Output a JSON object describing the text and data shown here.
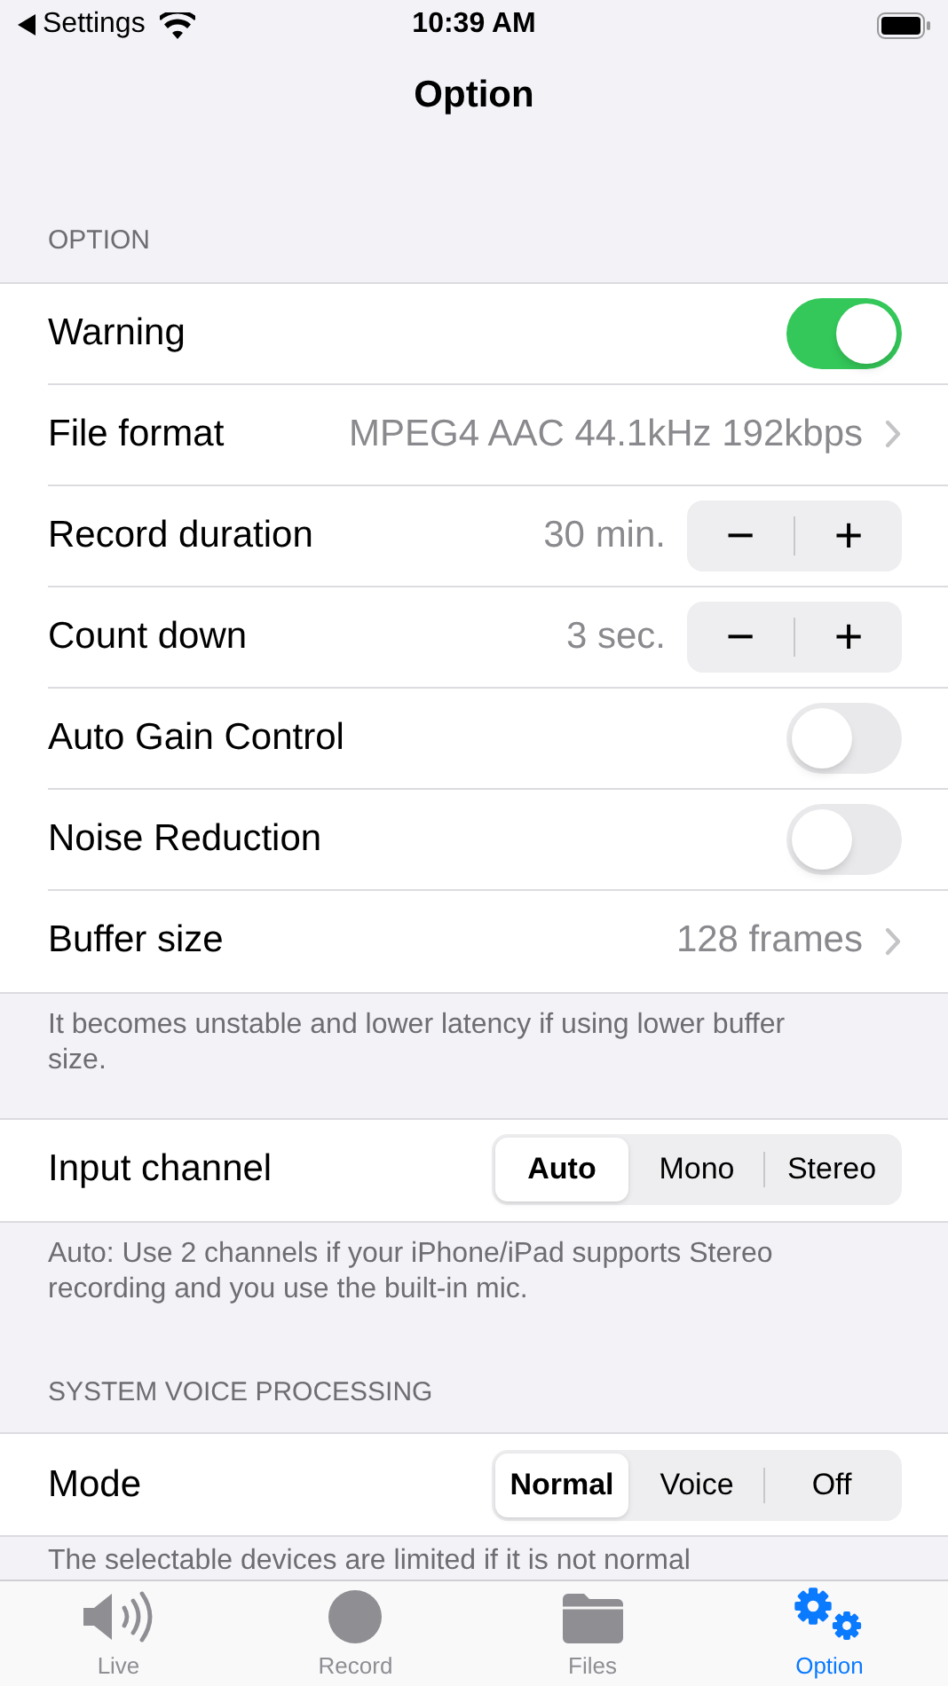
{
  "status_bar": {
    "back": "Settings",
    "time": "10:39 AM"
  },
  "nav": {
    "title": "Option"
  },
  "sections": [
    {
      "header": "OPTION",
      "footer": "It becomes unstable and lower latency if using lower buffer size.",
      "rows": [
        {
          "kind": "toggle",
          "label": "Warning",
          "on": true
        },
        {
          "kind": "disclosure",
          "label": "File format",
          "value": "MPEG4 AAC 44.1kHz 192kbps"
        },
        {
          "kind": "stepper",
          "label": "Record duration",
          "value": "30 min.",
          "minus": "−",
          "plus": "+"
        },
        {
          "kind": "stepper",
          "label": "Count down",
          "value": "3 sec.",
          "minus": "−",
          "plus": "+"
        },
        {
          "kind": "toggle",
          "label": "Auto Gain Control",
          "on": false
        },
        {
          "kind": "toggle",
          "label": "Noise Reduction",
          "on": false
        },
        {
          "kind": "disclosure",
          "label": "Buffer size",
          "value": "128 frames"
        }
      ]
    },
    {
      "footer": "Auto: Use 2 channels if your iPhone/iPad supports Stereo recording and you use the built-in mic.",
      "rows": [
        {
          "kind": "segmented",
          "label": "Input channel",
          "options": [
            {
              "label": "Auto",
              "selected": true
            },
            {
              "label": "Mono",
              "selected": false
            },
            {
              "label": "Stereo",
              "selected": false
            }
          ]
        }
      ]
    },
    {
      "header": "SYSTEM VOICE PROCESSING",
      "footer": "The selectable devices are limited if it is not normal",
      "rows": [
        {
          "kind": "segmented",
          "label": "Mode",
          "options": [
            {
              "label": "Normal",
              "selected": true
            },
            {
              "label": "Voice",
              "selected": false
            },
            {
              "label": "Off",
              "selected": false
            }
          ]
        }
      ]
    }
  ],
  "tab_bar": [
    {
      "label": "Live",
      "selected": false
    },
    {
      "label": "Record",
      "selected": false
    },
    {
      "label": "Files",
      "selected": false
    },
    {
      "label": "Option",
      "selected": true
    }
  ]
}
